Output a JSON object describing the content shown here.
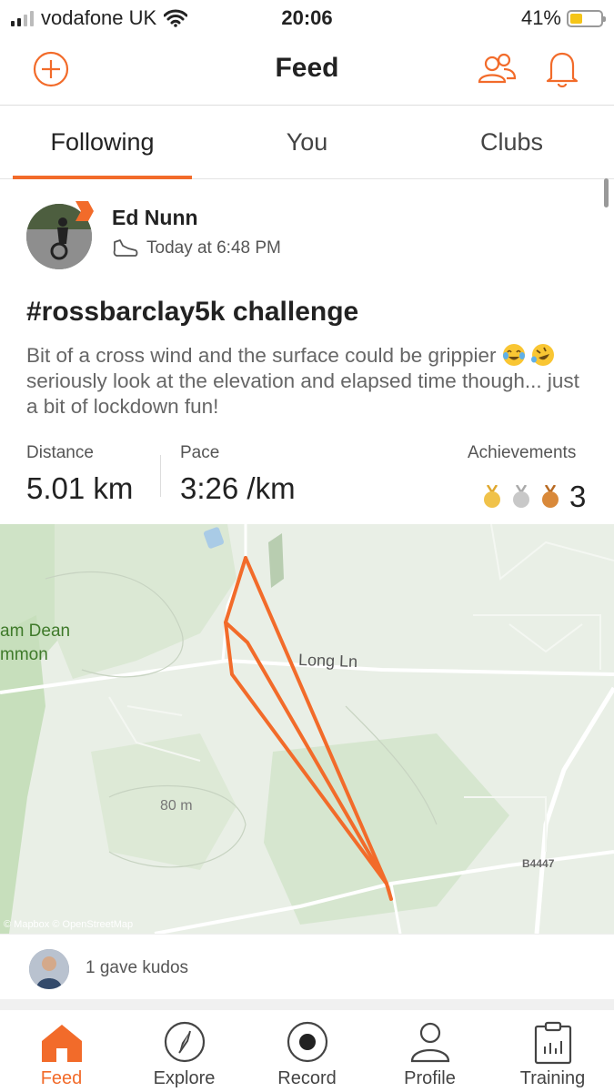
{
  "status_bar": {
    "carrier": "vodafone UK",
    "time": "20:06",
    "battery": "41%",
    "battery_level": 0.41
  },
  "header": {
    "title": "Feed",
    "icons": [
      "add-circle-icon",
      "people-icon",
      "bell-icon"
    ]
  },
  "tabs": [
    {
      "label": "Following",
      "active": true
    },
    {
      "label": "You",
      "active": false
    },
    {
      "label": "Clubs",
      "active": false
    }
  ],
  "post": {
    "athlete": "Ed Nunn",
    "time": "Today at 6:48 PM",
    "activity_icon": "shoe-icon",
    "title": "#rossbarclay5k challenge",
    "description_part1": "Bit of a cross wind and the surface could be grippier",
    "description_part2": "seriously look at the elevation and elapsed time though... just a bit of lockdown fun!",
    "stats": {
      "distance_label": "Distance",
      "distance_value": "5.01 km",
      "pace_label": "Pace",
      "pace_value": "3:26 /km",
      "achievements_label": "Achievements",
      "achievements_value": "3"
    },
    "map": {
      "labels": {
        "area_line1": "am Dean",
        "area_line2": "mmon",
        "road": "Long Ln",
        "elevation": "80 m",
        "road_code": "B4447"
      },
      "attribution": "© Mapbox © OpenStreetMap",
      "route_color": "#f26b2a"
    },
    "kudos": "1 gave kudos"
  },
  "bottom_nav": [
    {
      "label": "Feed",
      "icon": "home-icon",
      "active": true
    },
    {
      "label": "Explore",
      "icon": "compass-icon",
      "active": false
    },
    {
      "label": "Record",
      "icon": "record-icon",
      "active": false
    },
    {
      "label": "Profile",
      "icon": "profile-icon",
      "active": false
    },
    {
      "label": "Training",
      "icon": "training-icon",
      "active": false
    }
  ],
  "colors": {
    "accent": "#f26b2a",
    "gold": "#f0c24a",
    "silver": "#c8c8c8",
    "bronze": "#d9893a"
  }
}
